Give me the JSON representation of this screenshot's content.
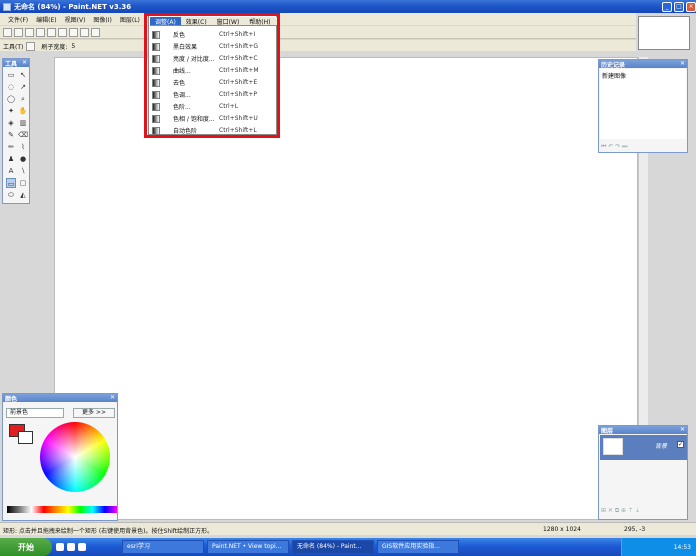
{
  "window": {
    "title": "无命名 (84%) - Paint.NET v3.36",
    "minimize": "_",
    "maximize": "□",
    "close": "×"
  },
  "menubar": [
    "文件(F)",
    "编辑(E)",
    "视图(V)",
    "图像(I)",
    "图层(L)"
  ],
  "toolbar2": {
    "tools_label": "工具(T)",
    "brush_width_label": "刷子宽度:",
    "brush_width": "5"
  },
  "adjust_menu": {
    "headers": [
      "调整(A)",
      "效果(C)",
      "窗口(W)",
      "帮助(H)"
    ],
    "items": [
      {
        "label": "反色",
        "shortcut": "Ctrl+Shift+I",
        "icon": "invert-colors-icon"
      },
      {
        "label": "黑白效果",
        "shortcut": "Ctrl+Shift+G",
        "icon": "black-white-icon"
      },
      {
        "label": "亮度 / 对比度...",
        "shortcut": "Ctrl+Shift+C",
        "icon": "brightness-contrast-icon"
      },
      {
        "label": "曲线...",
        "shortcut": "Ctrl+Shift+M",
        "icon": "curves-icon"
      },
      {
        "label": "去色",
        "shortcut": "Ctrl+Shift+E",
        "icon": "desaturate-icon"
      },
      {
        "label": "色调...",
        "shortcut": "Ctrl+Shift+P",
        "icon": "hue-icon"
      },
      {
        "label": "色阶...",
        "shortcut": "Ctrl+L",
        "icon": "levels-icon"
      },
      {
        "label": "色相 / 饱和度...",
        "shortcut": "Ctrl+Shift+U",
        "icon": "hue-saturation-icon"
      },
      {
        "label": "自动色阶",
        "shortcut": "Ctrl+Shift+L",
        "icon": "auto-level-icon"
      }
    ]
  },
  "tools_panel": {
    "title": "工具",
    "close": "✕"
  },
  "history_panel": {
    "title": "历史记录",
    "item": "新建图像",
    "close": "✕"
  },
  "layers_panel": {
    "title": "图层",
    "layer_name": "背景",
    "close": "✕"
  },
  "colors_panel": {
    "title": "颜色",
    "select": "前景色",
    "more": "更多 >>",
    "close": "✕",
    "primary": "#e02020",
    "secondary": "#ffffff"
  },
  "status": {
    "hint": "矩形: 点击并且拖拽来绘制一个矩形 (右键使用背景色)。按住Shift绘制正方形。",
    "size": "1280 x 1024",
    "cursor": "295, -3"
  },
  "taskbar": {
    "start": "开始",
    "tasks": [
      "esri学习",
      "Paint.NET • View topi...",
      "无命名 (84%) - Paint...",
      "GIS软件应用实验指..."
    ],
    "clock": "14:53"
  }
}
